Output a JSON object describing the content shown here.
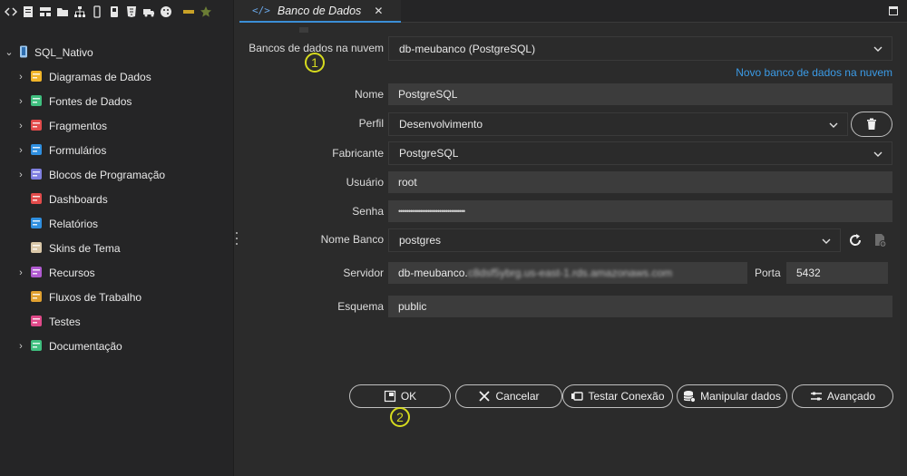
{
  "toolbar": {
    "icons": [
      "code-icon",
      "document-icon",
      "layout-icon",
      "folder-icon",
      "hierarchy-icon",
      "mobile-icon",
      "device-icon",
      "html5-icon",
      "truck-icon",
      "palette-icon",
      "bar-icon",
      "star-icon"
    ]
  },
  "tree": {
    "root": {
      "label": "SQL_Nativo",
      "icon": "database-icon"
    },
    "items": [
      {
        "label": "Diagramas de Dados",
        "icon": "hierarchy-icon",
        "color": "#f0b429",
        "expandable": true
      },
      {
        "label": "Fontes de Dados",
        "icon": "datasource-icon",
        "color": "#3fbf7f",
        "expandable": true
      },
      {
        "label": "Fragmentos",
        "icon": "fragment-icon",
        "color": "#e24b4b",
        "expandable": true
      },
      {
        "label": "Formulários",
        "icon": "form-icon",
        "color": "#2f8fe0",
        "expandable": true
      },
      {
        "label": "Blocos de Programação",
        "icon": "blocks-icon",
        "color": "#7f7fe0",
        "expandable": true
      },
      {
        "label": "Dashboards",
        "icon": "dashboard-icon",
        "color": "#e24b4b",
        "expandable": false
      },
      {
        "label": "Relatórios",
        "icon": "report-icon",
        "color": "#2f8fe0",
        "expandable": false
      },
      {
        "label": "Skins de Tema",
        "icon": "palette-icon",
        "color": "#d9c7a8",
        "expandable": false
      },
      {
        "label": "Recursos",
        "icon": "resources-icon",
        "color": "#b05ad0",
        "expandable": true
      },
      {
        "label": "Fluxos de Trabalho",
        "icon": "workflow-icon",
        "color": "#e0a030",
        "expandable": false
      },
      {
        "label": "Testes",
        "icon": "test-icon",
        "color": "#e04a8a",
        "expandable": false
      },
      {
        "label": "Documentação",
        "icon": "book-icon",
        "color": "#3fbf7f",
        "expandable": true
      }
    ]
  },
  "tab": {
    "label": "Banco de Dados",
    "close": "✕"
  },
  "form": {
    "cloud_db_label": "Bancos de dados na nuvem",
    "cloud_db_value": "db-meubanco (PostgreSQL)",
    "new_db_link": "Novo banco de dados na nuvem",
    "name_label": "Nome",
    "name_value": "PostgreSQL",
    "profile_label": "Perfil",
    "profile_value": "Desenvolvimento",
    "vendor_label": "Fabricante",
    "vendor_value": "PostgreSQL",
    "user_label": "Usuário",
    "user_value": "root",
    "password_label": "Senha",
    "password_value": "••••••••••••••••••••••••••••••••••",
    "dbname_label": "Nome Banco",
    "dbname_value": "postgres",
    "server_label": "Servidor",
    "server_value": "db-meubanco.",
    "server_value_blurred": "c8dsf5ybrg.us-east-1.rds.amazonaws.com",
    "port_label": "Porta",
    "port_value": "5432",
    "schema_label": "Esquema",
    "schema_value": "public"
  },
  "buttons": {
    "ok": "OK",
    "cancel": "Cancelar",
    "test": "Testar Conexão",
    "manipulate": "Manipular dados",
    "advanced": "Avançado"
  },
  "badges": {
    "one": "1",
    "two": "2"
  },
  "colors": {
    "accent": "#3b8ed6",
    "link": "#3b9be6",
    "badge": "#d6db1e"
  }
}
